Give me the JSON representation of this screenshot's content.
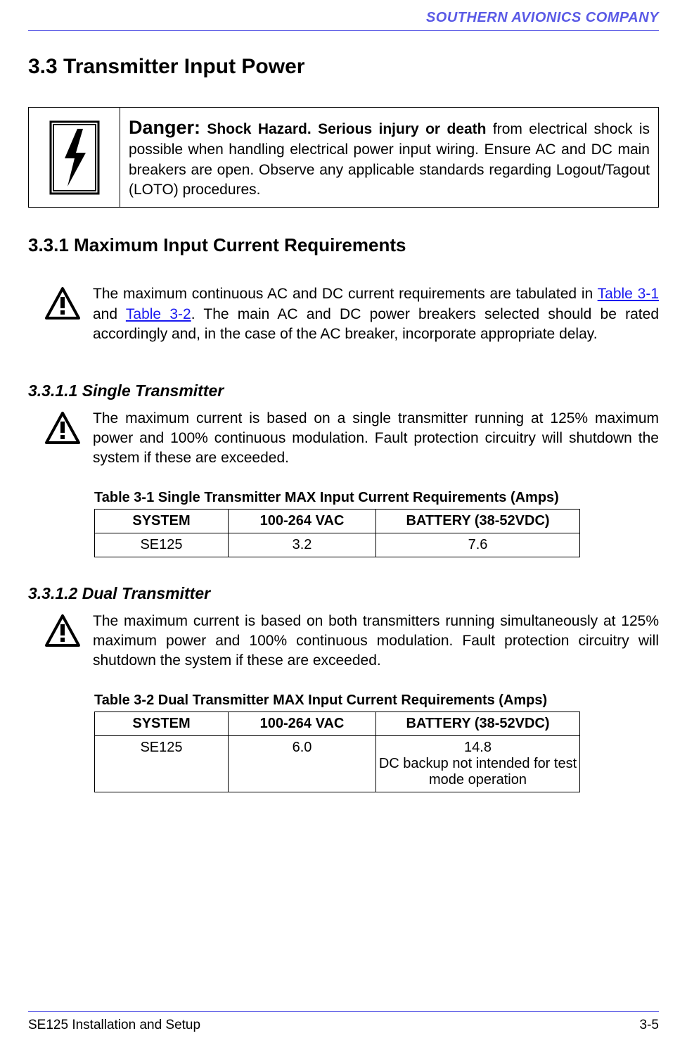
{
  "header": {
    "company": "SOUTHERN AVIONICS COMPANY"
  },
  "section": {
    "number_title": "3.3  Transmitter Input Power"
  },
  "danger": {
    "label": "Danger:",
    "strong_text": "  Shock Hazard.  Serious injury or death",
    "body": " from electrical shock is possible when handling electrical power input wiring.  Ensure AC and DC main breakers are open.  Observe any applicable standards regarding Logout/Tagout (LOTO) procedures."
  },
  "subsection": {
    "number_title": "3.3.1  Maximum Input Current Requirements"
  },
  "caution1": {
    "pre": "The maximum continuous AC and DC current requirements are tabulated in   ",
    "link1": "Table 3-1",
    "mid": "  and ",
    "link2": "Table 3-2",
    "post": ". The main AC and DC power breakers selected should be rated accordingly and, in the case of the AC breaker, incorporate appropriate delay."
  },
  "sub311": {
    "number_title": "3.3.1.1  Single Transmitter",
    "caution": "The maximum current is based on a single transmitter running at 125% maximum power and 100% continuous modulation.  Fault protection circuitry will shutdown the system if these are exceeded."
  },
  "table31": {
    "caption": "Table 3-1  Single Transmitter MAX Input Current Requirements (Amps)",
    "headers": {
      "c1": "SYSTEM",
      "c2": "100-264 VAC",
      "c3": "BATTERY (38-52VDC)"
    },
    "row": {
      "c1": "SE125",
      "c2": "3.2",
      "c3": "7.6"
    }
  },
  "sub312": {
    "number_title": "3.3.1.2  Dual Transmitter",
    "caution": "The maximum current is based on both transmitters running simultaneously at 125% maximum power and 100% continuous modulation. Fault protection circuitry will shutdown the system if these are exceeded."
  },
  "table32": {
    "caption": "Table 3-2  Dual Transmitter MAX Input Current Requirements (Amps)",
    "headers": {
      "c1": "SYSTEM",
      "c2": "100-264 VAC",
      "c3": "BATTERY (38-52VDC)"
    },
    "row": {
      "c1": "SE125",
      "c2": "6.0",
      "c3_l1": "14.8",
      "c3_l2": "DC backup not intended for test mode operation"
    }
  },
  "footer": {
    "left": "SE125 Installation and Setup",
    "right": "3-5"
  },
  "chart_data": [
    {
      "type": "table",
      "title": "Table 3-1  Single Transmitter MAX Input Current Requirements (Amps)",
      "columns": [
        "SYSTEM",
        "100-264 VAC",
        "BATTERY (38-52VDC)"
      ],
      "rows": [
        [
          "SE125",
          3.2,
          7.6
        ]
      ]
    },
    {
      "type": "table",
      "title": "Table 3-2  Dual Transmitter MAX Input Current Requirements (Amps)",
      "columns": [
        "SYSTEM",
        "100-264 VAC",
        "BATTERY (38-52VDC)"
      ],
      "rows": [
        [
          "SE125",
          6.0,
          "14.8 — DC backup not intended for test mode operation"
        ]
      ]
    }
  ]
}
